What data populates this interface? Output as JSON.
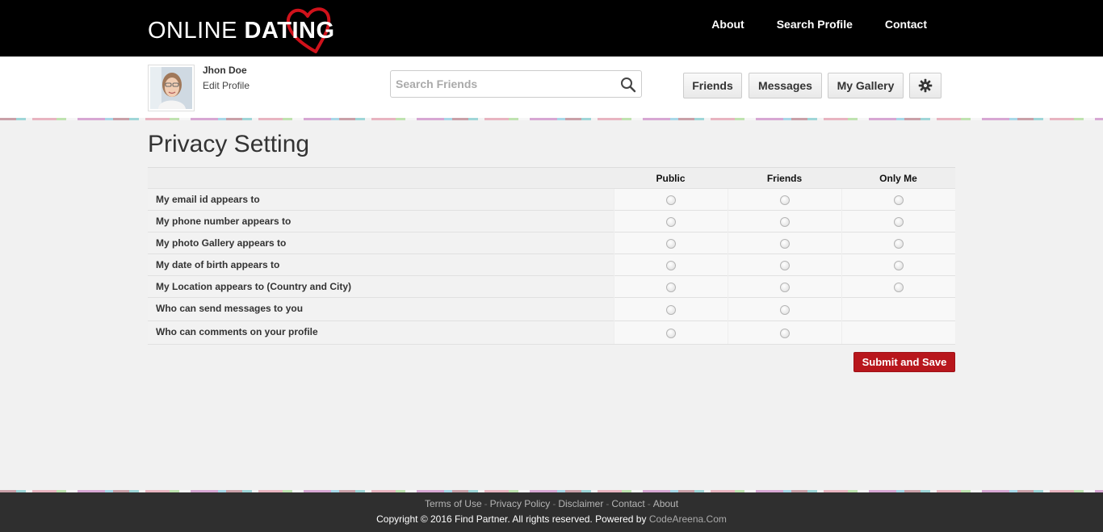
{
  "header": {
    "logo_thin": "ONLINE",
    "logo_bold": "DATING",
    "nav": [
      "About",
      "Search Profile",
      "Contact"
    ]
  },
  "profile": {
    "name": "Jhon Doe",
    "edit_label": "Edit Profile",
    "search_placeholder": "Search Friends",
    "buttons": {
      "friends": "Friends",
      "messages": "Messages",
      "gallery": "My Gallery",
      "settings_icon": "gear-icon"
    }
  },
  "page": {
    "title": "Privacy Setting",
    "columns": [
      "Public",
      "Friends",
      "Only Me"
    ],
    "rows": [
      {
        "label": "My email id appears to",
        "options": 3
      },
      {
        "label": "My phone number appears to",
        "options": 3
      },
      {
        "label": "My photo Gallery appears to",
        "options": 3
      },
      {
        "label": "My date of birth appears to",
        "options": 3
      },
      {
        "label": "My Location appears to (Country and City)",
        "options": 3
      },
      {
        "label": "Who can send messages to you",
        "options": 2
      },
      {
        "label": "Who can comments on your profile",
        "options": 2
      }
    ],
    "submit_label": "Submit and Save"
  },
  "footer": {
    "links": [
      "Terms of Use",
      "Privacy Policy",
      "Disclaimer",
      "Contact",
      "About"
    ],
    "separator": "-",
    "copyright_prefix": "Copyright © 2016 Find Partner. All rights reserved. Powered by",
    "copyright_brand": "CodeAreena.Com"
  },
  "colors": {
    "accent": "#b8161c",
    "topbar": "#000000",
    "footer": "#2f2f2f"
  }
}
